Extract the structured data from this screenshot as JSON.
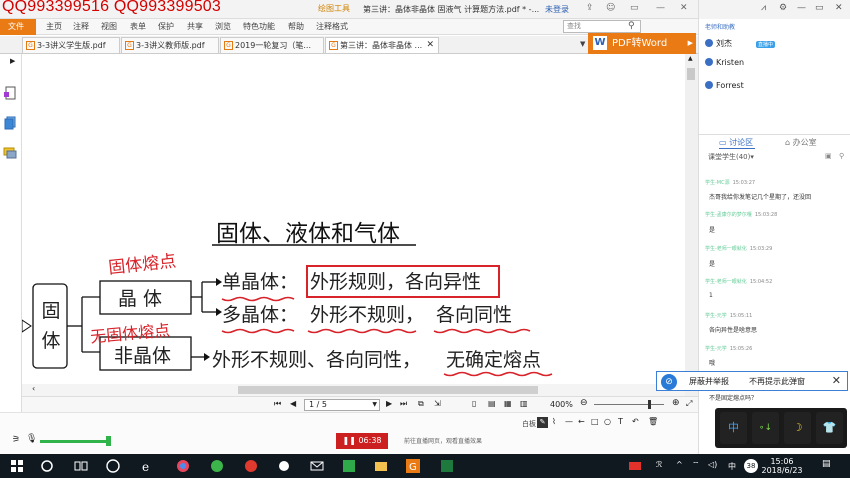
{
  "watermark": "QQ993399516  QQ993399503",
  "titlebar": {
    "tool_tab": "绘图工具",
    "doc_title": "第三讲：晶体非晶体 固液气 计算题方法.pdf * -...",
    "login": "未登录"
  },
  "menu": {
    "file": "文件",
    "items": [
      "主页",
      "注释",
      "视图",
      "表单",
      "保护",
      "共享",
      "浏览",
      "特色功能",
      "帮助",
      "注释格式"
    ],
    "find_placeholder": "查找"
  },
  "tabs": [
    {
      "label": "3-3讲义学生版.pdf"
    },
    {
      "label": "3-3讲义教师版.pdf"
    },
    {
      "label": "2019一轮复习（笔..."
    },
    {
      "label": "第三讲：晶体非晶体 ..."
    }
  ],
  "pdf_to_word": {
    "icon": "W",
    "label": "PDF转Word"
  },
  "slide": {
    "title": "固体、液体和气体",
    "root": "固\n体",
    "crystal": "晶 体",
    "amorphous": "非晶体",
    "single_crystal": "单晶体：",
    "single_crystal_props": "外形规则，各向异性",
    "poly_crystal": "多晶体：",
    "poly_shape": "外形不规则，",
    "poly_iso": "各向同性",
    "amorphous_props": "外形不规则、各向同性，",
    "amorphous_melt": "无确定熔点",
    "note_melting": "固体熔点",
    "note_no_melting": "无固体熔点"
  },
  "doc_toolbar": {
    "page": "1 / 5",
    "zoom": "400%"
  },
  "livebar": {
    "timer": "06:38",
    "info": "前往直播网页，观看直播效果",
    "whiteboard": "白板"
  },
  "right_panel": {
    "teacher_label": "老师和助教",
    "members": [
      "刘杰",
      "Kristen",
      "Forrest"
    ],
    "badge": "直播中",
    "tab_discussion": "讨论区",
    "tab_office": "办公室",
    "classmates": "课堂学生(40)",
    "messages": [
      {
        "from": "学生-MC源",
        "time": "15:03:27",
        "text": "杰哥我给你发笔记几个星期了，还没回"
      },
      {
        "from": "学生-孟康尔的梦尔嘎",
        "time": "15:03:28",
        "text": "是"
      },
      {
        "from": "学生-老师一眼就化",
        "time": "15:03:29",
        "text": "是"
      },
      {
        "from": "学生-老师一眼就化",
        "time": "15:04:52",
        "text": "1"
      },
      {
        "from": "学生-元学",
        "time": "15:05:11",
        "text": "各向异性是啥意思"
      },
      {
        "from": "学生-元学",
        "time": "15:05:26",
        "text": "哦"
      }
    ],
    "last_line": "不是固定熔点吗？"
  },
  "notice": {
    "report": "屏蔽并举报",
    "dismiss": "不再提示此弹窗"
  },
  "palette": [
    "中",
    "∘↓",
    "☽",
    "👕"
  ],
  "taskbar": {
    "time": "15:06",
    "date": "2018/6/23",
    "badge": "38",
    "ime": "中"
  }
}
